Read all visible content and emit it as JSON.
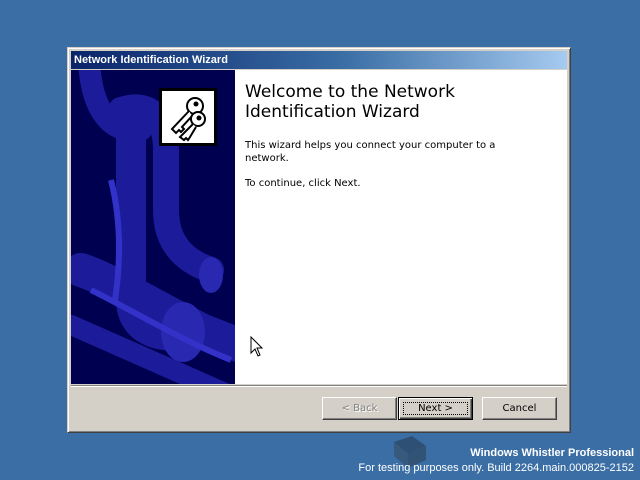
{
  "window": {
    "title": "Network Identification Wizard"
  },
  "wizard": {
    "heading": "Welcome to the Network Identification Wizard",
    "description": "This wizard helps you connect your computer to a network.",
    "instruction": "To continue, click Next.",
    "banner_icon": "keys-icon"
  },
  "buttons": {
    "back": "< Back",
    "next": "Next >",
    "cancel": "Cancel"
  },
  "desktop": {
    "edition": "Windows Whistler Professional",
    "build_note": "For testing purposes only. Build 2264.main.000825-2152"
  },
  "colors": {
    "desktop": "#3a6ea5",
    "title_active": "#0a246a",
    "banner": "#000050",
    "face": "#d4d0c8"
  }
}
